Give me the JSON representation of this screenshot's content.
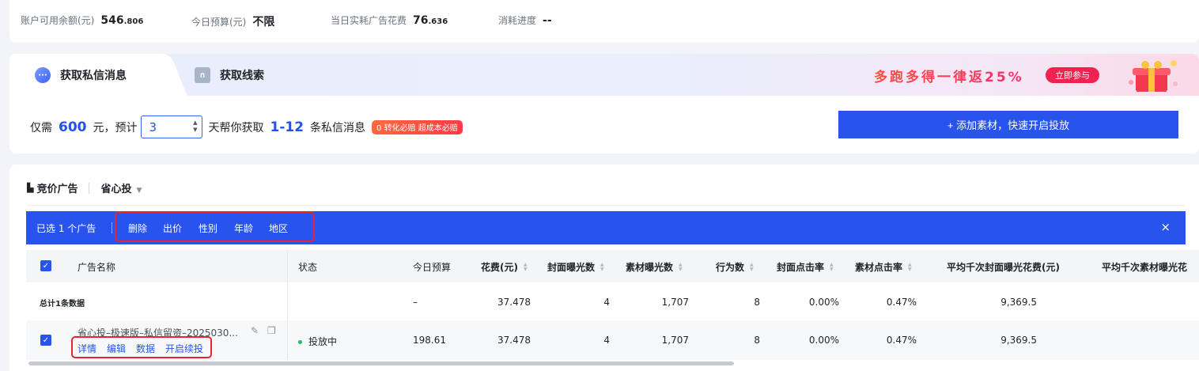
{
  "stats": [
    {
      "label": "账户可用余额(元)",
      "int": "546",
      "dec": ".806"
    },
    {
      "label": "今日预算(元)",
      "int": "不限",
      "dec": ""
    },
    {
      "label": "当日实耗广告花费",
      "int": "76",
      "dec": ".636"
    },
    {
      "label": "消耗进度",
      "int": "--",
      "dec": ""
    }
  ],
  "tabs": [
    {
      "label": "获取私信消息",
      "icon": "chat-bubble-icon"
    },
    {
      "label": "获取线索",
      "icon": "leads-icon"
    }
  ],
  "promo": {
    "text": "多跑多得一律返25%",
    "button": "立即参与"
  },
  "budget": {
    "prefix": "仅需",
    "amount": "600",
    "unit": "元，预计",
    "days": "3",
    "mid": "天帮你获取",
    "range": "1-12",
    "suffix": "条私信消息",
    "badge": "0 转化必赔 超成本必赔"
  },
  "add_button": "+ 添加素材，快速开启投放",
  "ads_header": {
    "title": "竞价广告",
    "mode": "省心投"
  },
  "selection": {
    "text": "已选 1 个广告",
    "actions": [
      "删除",
      "出价",
      "性别",
      "年龄",
      "地区"
    ],
    "close": "×"
  },
  "table": {
    "columns": {
      "name": "广告名称",
      "status": "状态",
      "budget": "今日预算",
      "cost": "花费(元)",
      "cover_imp": "封面曝光数",
      "material_imp": "素材曝光数",
      "actions": "行为数",
      "cover_ctr": "封面点击率",
      "material_ctr": "素材点击率",
      "cpm_cover": "平均千次封面曝光花费(元)",
      "cpm_material": "平均千次素材曝光花"
    },
    "total": {
      "label": "总计1条数据",
      "budget": "–",
      "cost": "37.478",
      "cover_imp": "4",
      "material_imp": "1,707",
      "actions": "8",
      "cover_ctr": "0.00%",
      "material_ctr": "0.47%",
      "cpm_cover": "9,369.5"
    },
    "row": {
      "name": "省心投–极速版–私信留资–2025030...",
      "links": [
        "详情",
        "编辑",
        "数据",
        "开启续投"
      ],
      "status": "投放中",
      "budget": "198.61",
      "cost": "37.478",
      "cover_imp": "4",
      "material_imp": "1,707",
      "actions": "8",
      "cover_ctr": "0.00%",
      "material_ctr": "0.47%",
      "cpm_cover": "9,369.5"
    }
  },
  "colors": {
    "primary": "#2854ed",
    "highlight": "#e3262f",
    "status_running": "#1fbd6b"
  }
}
